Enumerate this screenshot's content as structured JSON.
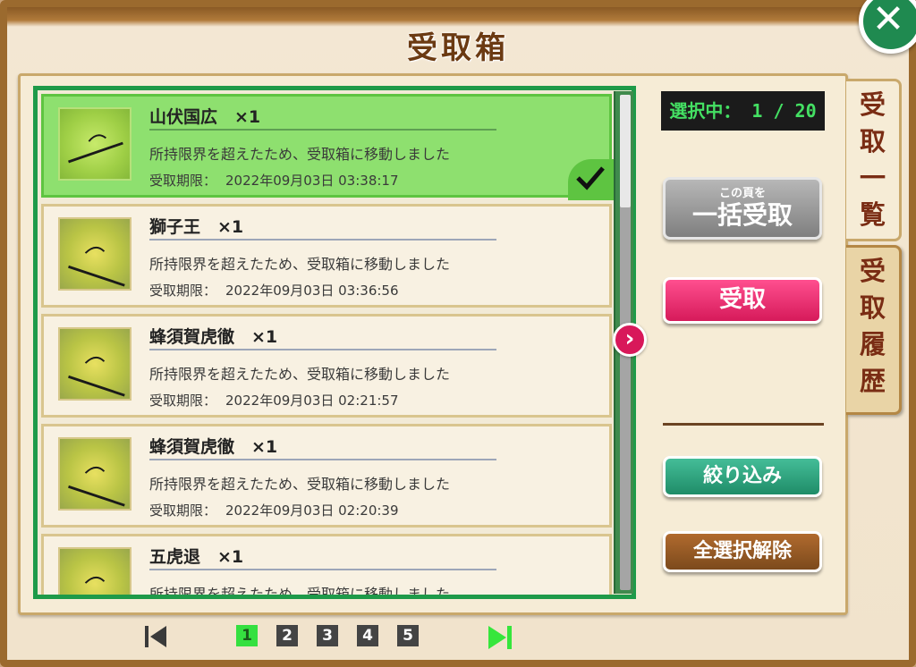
{
  "window": {
    "title": "受取箱",
    "close_label": "✕"
  },
  "counter": {
    "text": "選択中： 1 / 20"
  },
  "items": [
    {
      "name": "山伏国広　×1",
      "desc": "所持限界を超えたため、受取箱に移動しました",
      "deadline_label": "受取期限：",
      "deadline": "2022年09月03日 03:38:17",
      "selected": true
    },
    {
      "name": "獅子王　×1",
      "desc": "所持限界を超えたため、受取箱に移動しました",
      "deadline_label": "受取期限：",
      "deadline": "2022年09月03日 03:36:56",
      "selected": false
    },
    {
      "name": "蜂須賀虎徹　×1",
      "desc": "所持限界を超えたため、受取箱に移動しました",
      "deadline_label": "受取期限：",
      "deadline": "2022年09月03日 02:21:57",
      "selected": false
    },
    {
      "name": "蜂須賀虎徹　×1",
      "desc": "所持限界を超えたため、受取箱に移動しました",
      "deadline_label": "受取期限：",
      "deadline": "2022年09月03日 02:20:39",
      "selected": false
    },
    {
      "name": "五虎退　×1",
      "desc": "所持限界を超えたため、受取箱に移動しました",
      "deadline_label": "",
      "deadline": "",
      "selected": false
    }
  ],
  "buttons": {
    "bulk_small": "この頁を",
    "bulk_big": "一括受取",
    "receive": "受取",
    "filter": "絞り込み",
    "deselect": "全選択解除",
    "next_arrow": "›"
  },
  "tabs": [
    {
      "chars": [
        "受",
        "取",
        "一",
        "覧"
      ],
      "active": true
    },
    {
      "chars": [
        "受",
        "取",
        "履",
        "歴"
      ],
      "active": false
    }
  ],
  "pager": {
    "pages": [
      "1",
      "2",
      "3",
      "4",
      "5"
    ],
    "current": "1"
  },
  "scroll": {
    "position_fraction": 0.0,
    "visible_fraction": 0.23
  },
  "colors": {
    "accent_green": "#1e9a49",
    "receive_pink": "#d61a5a",
    "filter_teal": "#1f8c68",
    "deselect_brown": "#7c4a1c",
    "counter_text": "#44e063"
  },
  "icons": {
    "sword": "sword-icon",
    "check": "check-icon",
    "first": "first-page-icon",
    "last": "last-page-icon"
  }
}
